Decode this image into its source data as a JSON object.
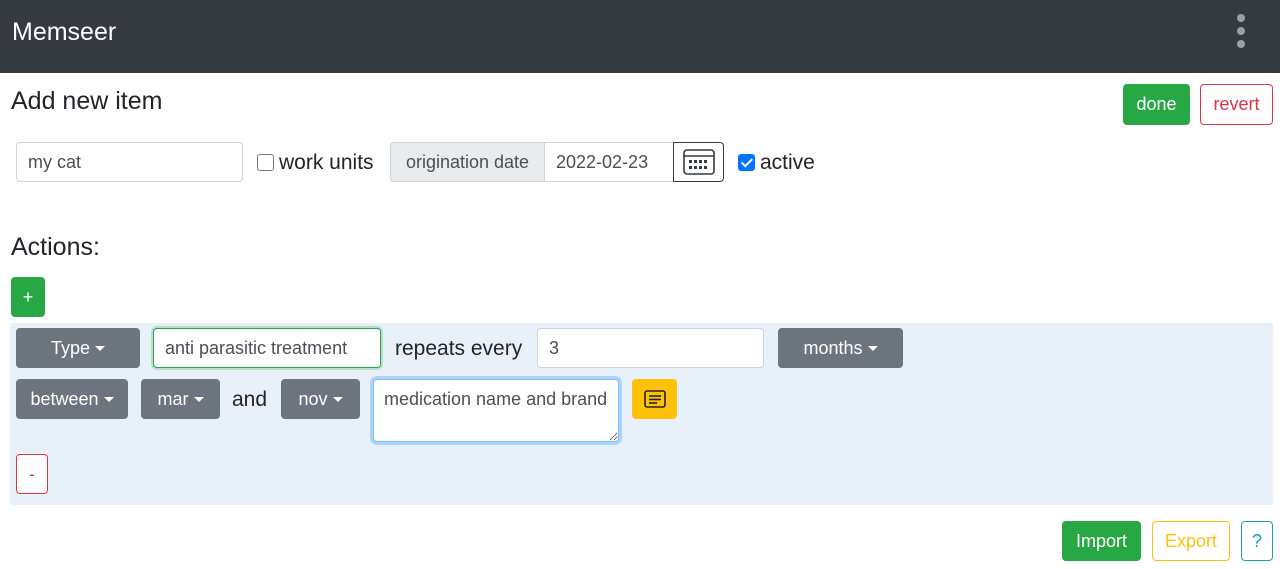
{
  "app": {
    "title": "Memseer"
  },
  "page": {
    "heading": "Add new item"
  },
  "toolbar": {
    "done_label": "done",
    "revert_label": "revert"
  },
  "item": {
    "name_value": "my cat",
    "work_units_label": "work units",
    "work_units_checked": false,
    "origination_date_label": "origination date",
    "origination_date_value": "2022-02-23",
    "active_label": "active",
    "active_checked": true
  },
  "actions": {
    "heading": "Actions:",
    "add_label": "+",
    "remove_label": "-",
    "rows": [
      {
        "type_label": "Type",
        "name_value": "anti parasitic treatment",
        "repeats_label": "repeats every",
        "interval_value": "3",
        "unit_label": "months",
        "window_label": "between",
        "from_month": "mar",
        "and_label": "and",
        "to_month": "nov",
        "note_value": "medication name and brand"
      }
    ]
  },
  "footer": {
    "import_label": "Import",
    "export_label": "Export",
    "help_label": "?"
  },
  "colors": {
    "navbar": "#343a40",
    "success": "#28a745",
    "danger": "#dc3545",
    "warning": "#ffc107",
    "info": "#17a2b8",
    "secondary": "#6c757d",
    "panel": "#e8f1fa"
  },
  "icons": {
    "menu": "kebab-menu-icon",
    "calendar": "calendar-icon",
    "note": "note-icon"
  }
}
